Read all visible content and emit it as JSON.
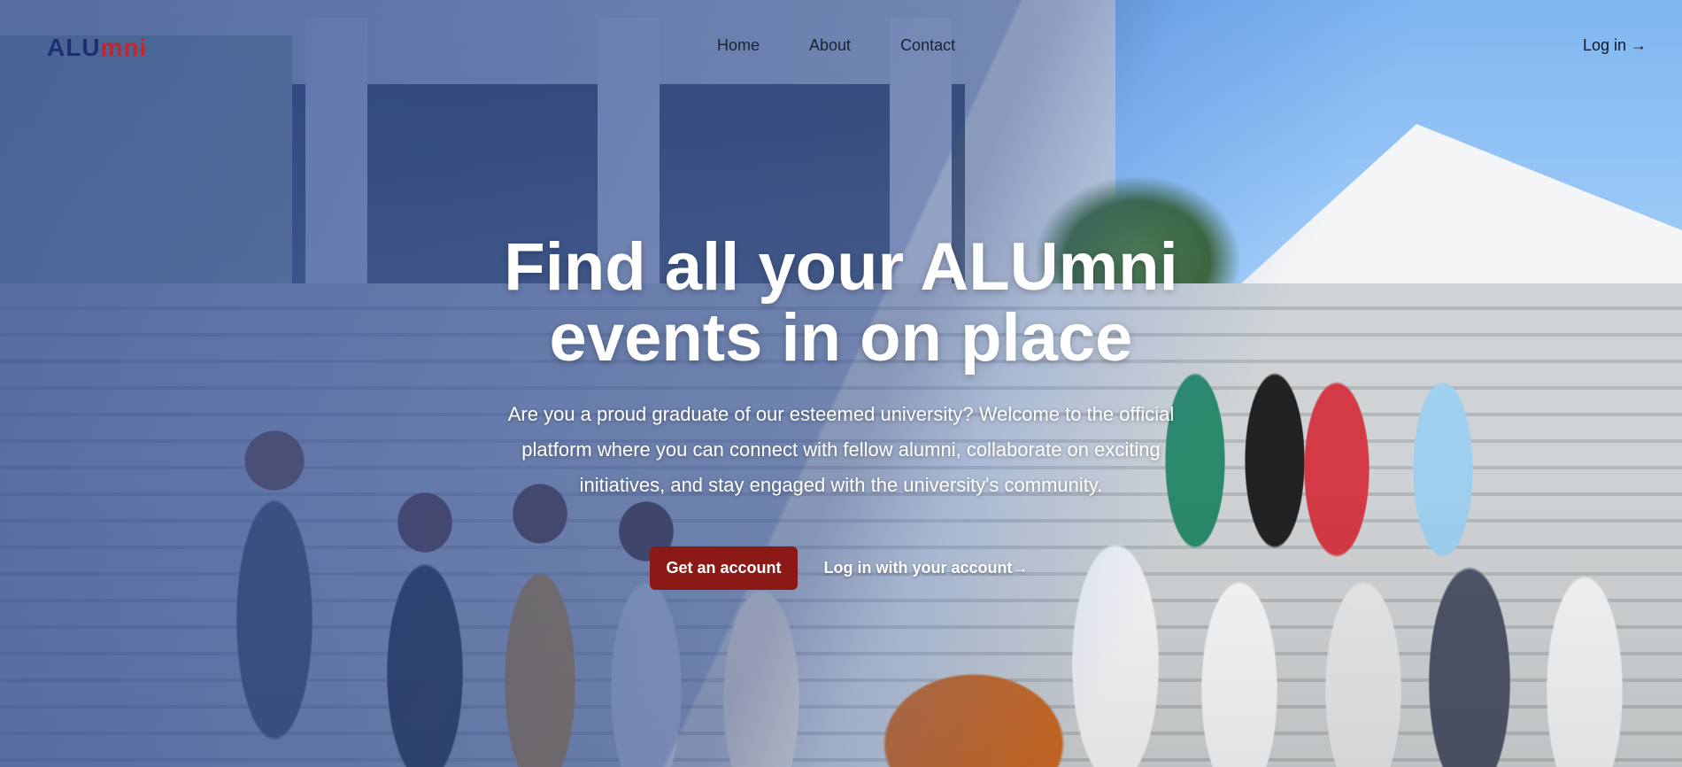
{
  "brand": {
    "part1": "ALU",
    "part2": "mni"
  },
  "nav": {
    "links": [
      {
        "label": "Home"
      },
      {
        "label": "About"
      },
      {
        "label": "Contact"
      }
    ],
    "login_label": "Log in",
    "login_arrow": "→"
  },
  "hero": {
    "title_line1": "Find all your ALUmni",
    "title_line2": "events in on place",
    "subtitle": "Are you a proud graduate of our esteemed university? Welcome to the official platform where you can connect with fellow alumni, collaborate on exciting initiatives, and stay engaged with the university's community.",
    "primary_cta": "Get an account",
    "secondary_cta": "Log in with your account",
    "secondary_arrow": "→"
  },
  "colors": {
    "brand_blue": "#1d2f6e",
    "brand_red": "#c1272d",
    "cta_bg": "#8b1a16"
  }
}
